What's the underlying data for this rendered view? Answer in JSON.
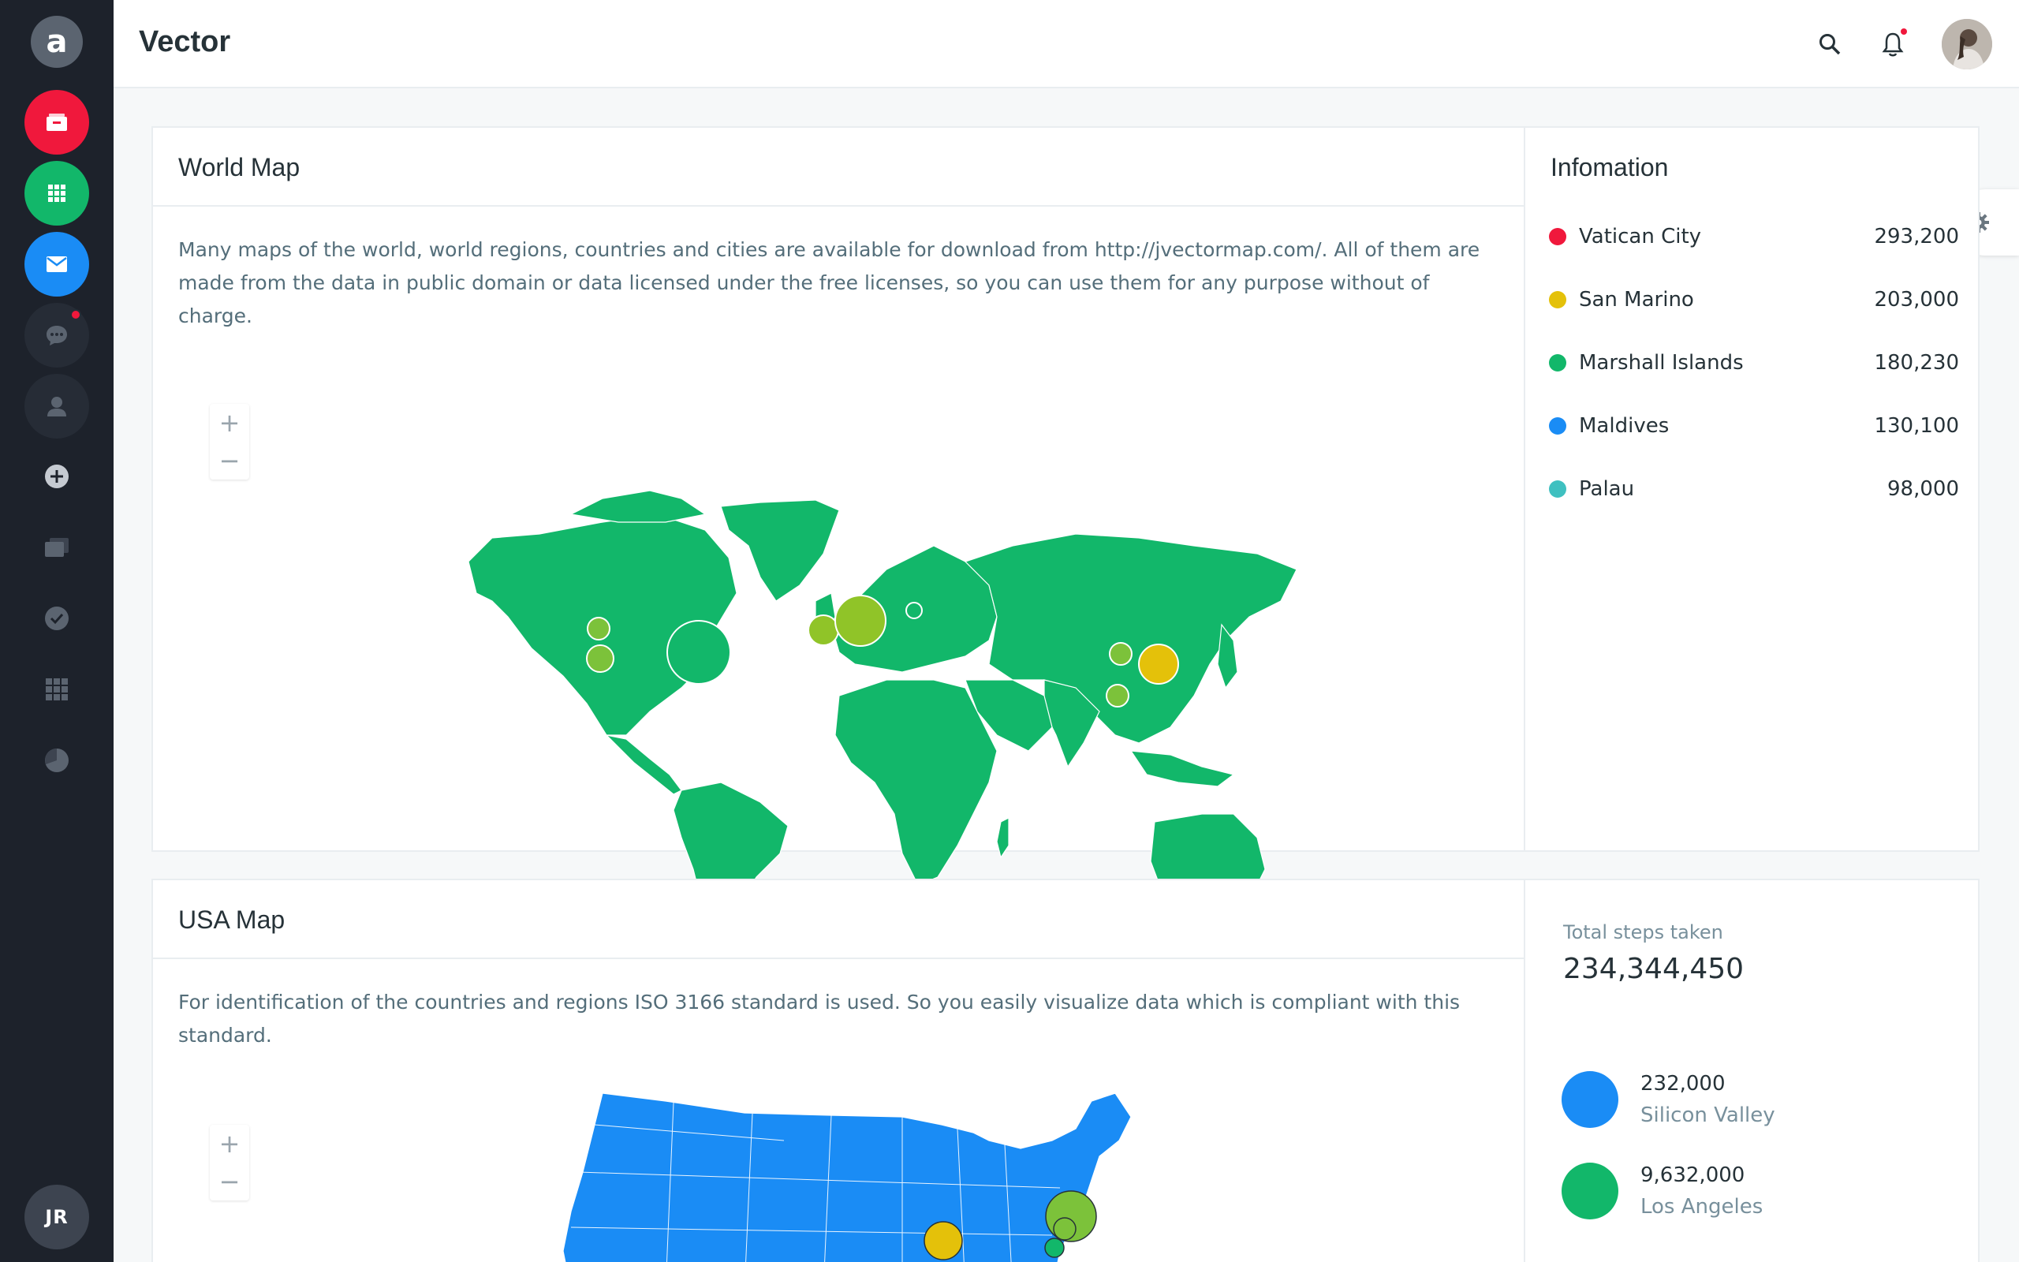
{
  "app": {
    "logo_letter": "a",
    "user_initials": "JR"
  },
  "header": {
    "title": "Vector"
  },
  "world_card": {
    "title": "World Map",
    "description": "Many maps of the world, world regions, countries and cities are available for download from http://jvectormap.com/. All of them are made from the data in public domain or data licensed under the free licenses, so you can use them for any purpose without of charge.",
    "zoom_in": "+",
    "zoom_out": "−",
    "map_color": "#12b76a"
  },
  "info_card": {
    "title": "Infomation",
    "items": [
      {
        "name": "Vatican City",
        "value": "293,200",
        "color": "#f0183c"
      },
      {
        "name": "San Marino",
        "value": "203,000",
        "color": "#e4c10a"
      },
      {
        "name": "Marshall Islands",
        "value": "180,230",
        "color": "#12b76a"
      },
      {
        "name": "Maldives",
        "value": "130,100",
        "color": "#1a8cf5"
      },
      {
        "name": "Palau",
        "value": "98,000",
        "color": "#3fc0c0"
      }
    ]
  },
  "usa_card": {
    "title": "USA Map",
    "description": "For identification of the countries and regions ISO 3166 standard is used. So you easily visualize data which is compliant with this standard.",
    "zoom_in": "+",
    "zoom_out": "−",
    "map_color": "#1a8cf5"
  },
  "steps_card": {
    "label": "Total steps taken",
    "value": "234,344,450",
    "stats": [
      {
        "number": "232,000",
        "label": "Silicon Valley",
        "color": "#1a8cf5"
      },
      {
        "number": "9,632,000",
        "label": "Los Angeles",
        "color": "#12b76a"
      }
    ]
  }
}
